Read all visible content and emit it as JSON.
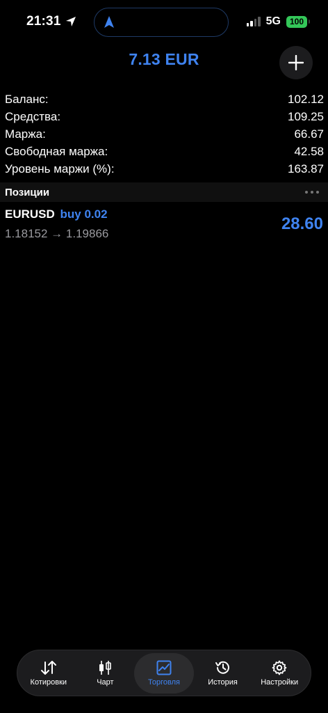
{
  "status_bar": {
    "time": "21:31",
    "network": "5G",
    "battery": "100"
  },
  "header": {
    "total": "7.13 EUR"
  },
  "summary": [
    {
      "label": "Баланс:",
      "value": "102.12"
    },
    {
      "label": "Средства:",
      "value": "109.25"
    },
    {
      "label": "Маржа:",
      "value": "66.67"
    },
    {
      "label": "Свободная маржа:",
      "value": "42.58"
    },
    {
      "label": "Уровень маржи (%):",
      "value": "163.87"
    }
  ],
  "positions": {
    "title": "Позиции",
    "items": [
      {
        "symbol": "EURUSD",
        "side": "buy 0.02",
        "prices": "1.18152 → 1.19866",
        "profit": "28.60"
      }
    ]
  },
  "tabs": [
    {
      "label": "Котировки",
      "icon": "quotes-icon"
    },
    {
      "label": "Чарт",
      "icon": "chart-icon"
    },
    {
      "label": "Торговля",
      "icon": "trade-icon",
      "active": true
    },
    {
      "label": "История",
      "icon": "history-icon"
    },
    {
      "label": "Настройки",
      "icon": "settings-icon"
    }
  ],
  "colors": {
    "accent": "#3f83f0",
    "background": "#000000",
    "battery": "#34c759"
  }
}
